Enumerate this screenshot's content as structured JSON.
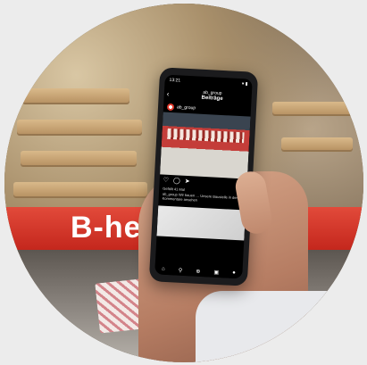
{
  "scene": {
    "barrier_text": "B-he",
    "barrier_color": "#d5352a"
  },
  "phone": {
    "status_time": "13:21",
    "status_icons": "▾ ▮",
    "header_user": "ab_group",
    "header_title": "Beiträge",
    "post_username": "ab_group",
    "caption_lines": [
      "Gefällt 41 Mal",
      "ab_group Wir bauen … Unsere Baustelle in der …",
      "Kommentare ansehen"
    ],
    "nav_icons": [
      "home-icon",
      "search-icon",
      "add-icon",
      "reels-icon",
      "profile-icon"
    ]
  }
}
